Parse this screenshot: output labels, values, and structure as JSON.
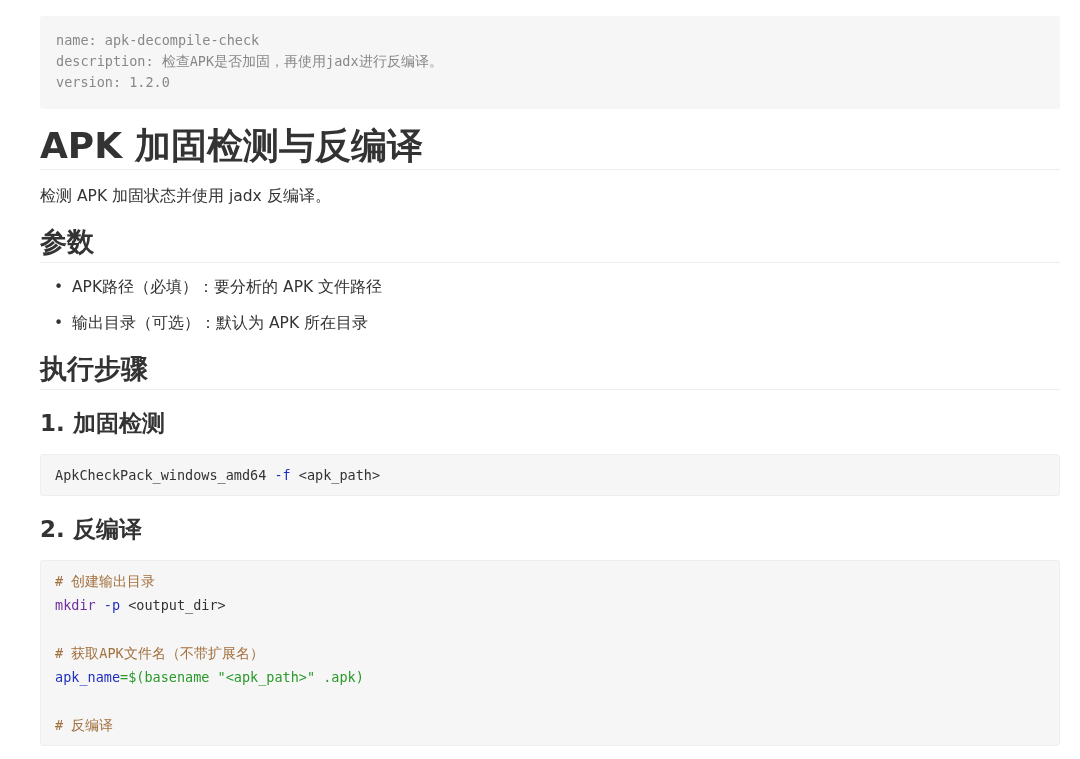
{
  "front_matter": [
    "name: apk-decompile-check",
    "description: 检查APK是否加固，再使用jadx进行反编译。",
    "version: 1.2.0"
  ],
  "title": "APK 加固检测与反编译",
  "intro": "检测 APK 加固状态并使用 jadx 反编译。",
  "sections": [
    {
      "kind": "h2",
      "text": "参数"
    },
    {
      "kind": "list",
      "items": [
        {
          "bullet": "•",
          "text": "APK路径（必填）：要分析的 APK 文件路径"
        },
        {
          "bullet": "•",
          "text": "输出目录（可选）：默认为 APK 所在目录"
        }
      ]
    },
    {
      "kind": "h2",
      "text": "执行步骤"
    },
    {
      "kind": "h3",
      "text": "1. 加固检测"
    },
    {
      "kind": "code",
      "lines": [
        {
          "kind": "code",
          "tokens": [
            {
              "kind": "plain",
              "text": "ApkCheckPack_windows_amd64 "
            },
            {
              "kind": "flag",
              "text": "-f"
            },
            {
              "kind": "plain",
              "text": " <apk_path>"
            }
          ]
        }
      ]
    },
    {
      "kind": "h3",
      "text": "2. 反编译"
    },
    {
      "kind": "code",
      "lines": [
        {
          "kind": "code",
          "tokens": [
            {
              "kind": "comment",
              "text": "# 创建输出目录"
            }
          ]
        },
        {
          "kind": "code",
          "tokens": [
            {
              "kind": "command",
              "text": "mkdir"
            },
            {
              "kind": "flag",
              "text": " -p"
            },
            {
              "kind": "plain",
              "text": " <output_dir>"
            }
          ]
        },
        {
          "kind": "blank"
        },
        {
          "kind": "code",
          "tokens": [
            {
              "kind": "comment",
              "text": "# 获取APK文件名（不带扩展名）"
            }
          ]
        },
        {
          "kind": "code",
          "tokens": [
            {
              "kind": "variable",
              "text": "apk_name"
            },
            {
              "kind": "string",
              "text": "=$(basename \"<apk_path>\" .apk)"
            }
          ]
        },
        {
          "kind": "blank"
        },
        {
          "kind": "code",
          "tokens": [
            {
              "kind": "comment",
              "text": "# 反编译"
            }
          ]
        }
      ]
    }
  ]
}
